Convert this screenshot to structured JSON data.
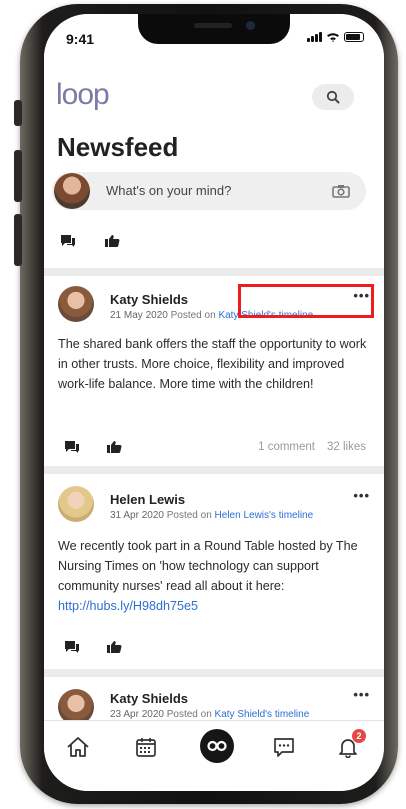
{
  "status_bar": {
    "time": "9:41"
  },
  "header": {
    "logo": "loop",
    "title": "Newsfeed",
    "composer_placeholder": "What's on your mind?"
  },
  "posts": [
    {
      "author": "Katy Shields",
      "date": "21 May 2020",
      "posted_on_prefix": "Posted on",
      "timeline_link": "Katy Shield's timeline",
      "more": "•••",
      "text": "The shared bank offers the staff the opportunity to work in other trusts. More choice, flexibility and improved work-life balance. More time with the children!",
      "comments": "1 comment",
      "likes": "32 likes"
    },
    {
      "author": "Helen Lewis",
      "date": "31 Apr 2020",
      "posted_on_prefix": "Posted on",
      "timeline_link": "Helen Lewis's timeline",
      "more": "•••",
      "text": "We recently took part in a Round Table hosted by The Nursing Times on 'how technology can support community nurses' read all about it here: ",
      "url": "http://hubs.ly/H98dh75e5"
    },
    {
      "author": "Katy Shields",
      "date": "23 Apr 2020",
      "posted_on_prefix": "Posted on",
      "timeline_link": "Katy Shield's timeline",
      "more": "•••"
    }
  ],
  "tabbar": {
    "notification_count": "2"
  },
  "colors": {
    "accent_link": "#2d6fd2",
    "highlight": "#ee1d1d",
    "badge": "#e54848"
  }
}
